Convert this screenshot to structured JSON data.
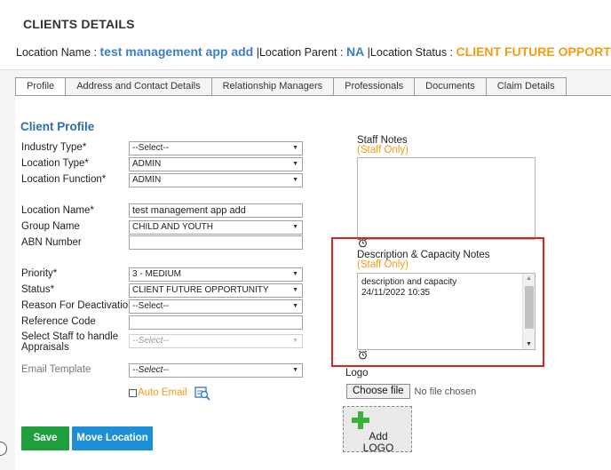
{
  "header": {
    "title": "CLIENTS DETAILS",
    "location_name_label": "Location Name :",
    "location_name_value": "test management app add",
    "location_parent_label": "|Location Parent :",
    "location_parent_value": "NA",
    "location_status_label": "|Location Status :",
    "location_status_value": "CLIENT FUTURE OPPORTUNIT"
  },
  "tabs": [
    "Profile",
    "Address and Contact Details",
    "Relationship Managers",
    "Professionals",
    "Documents",
    "Claim Details"
  ],
  "form": {
    "section_title": "Client Profile",
    "industry_type": {
      "label": "Industry Type*",
      "value": "--Select--"
    },
    "location_type": {
      "label": "Location Type*",
      "value": "ADMIN"
    },
    "location_function": {
      "label": "Location Function*",
      "value": "ADMIN"
    },
    "location_name": {
      "label": "Location Name*",
      "value": "test management app add"
    },
    "group_name": {
      "label": "Group Name",
      "value": "CHILD AND YOUTH"
    },
    "abn_number": {
      "label": "ABN Number",
      "value": ""
    },
    "priority": {
      "label": "Priority*",
      "value": "3 - MEDIUM"
    },
    "status": {
      "label": "Status*",
      "value": "CLIENT FUTURE OPPORTUNITY"
    },
    "reason_deactivation": {
      "label": "Reason For Deactivation",
      "value": "--Select--"
    },
    "reference_code": {
      "label": "Reference Code",
      "value": ""
    },
    "select_staff_line1": "Select Staff to handle",
    "select_staff_line2": "Appraisals",
    "select_staff_value": "--Select--",
    "email_template": {
      "label": "Email Template",
      "value": "--Select--"
    },
    "auto_email_label": "Auto Email"
  },
  "buttons": {
    "save": "Save",
    "move_location": "Move Location"
  },
  "right": {
    "staff_notes_label": "Staff Notes",
    "staff_only_1": "(Staff Only)",
    "desc_label": "Description & Capacity Notes",
    "staff_only_2": "(Staff Only)",
    "desc_text": "description and capacity\n24/11/2022 10:35",
    "logo_label": "Logo",
    "choose_file": "Choose file",
    "no_file": "No file chosen",
    "add_logo_line1": "Add",
    "add_logo_line2": "LOGO"
  },
  "colors": {
    "accent_blue": "#2c6eb1",
    "orange": "#f39c12",
    "save_green": "#1e9e3c",
    "move_blue": "#1d8fd9",
    "highlight_red": "#e02020"
  }
}
